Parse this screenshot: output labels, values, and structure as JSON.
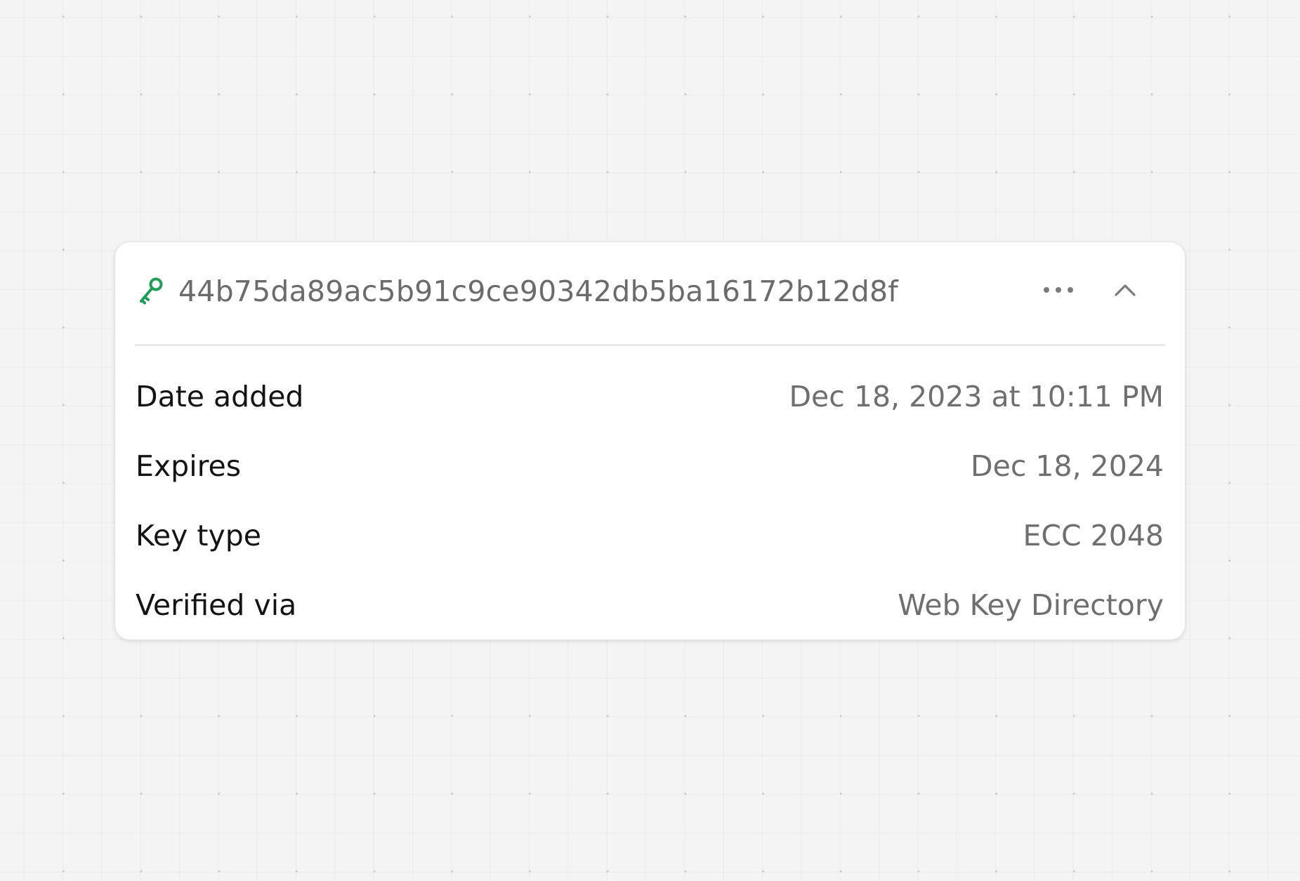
{
  "key_card": {
    "icon": "key-icon",
    "key_id": "44b75da89ac5b91c9ce90342db5ba16172b12d8f",
    "more_icon": "more-horizontal-icon",
    "collapse_icon": "chevron-up-icon",
    "accent_color": "#1f9d55",
    "details": [
      {
        "label": "Date added",
        "value": "Dec 18, 2023 at 10:11 PM"
      },
      {
        "label": "Expires",
        "value": "Dec 18, 2024"
      },
      {
        "label": "Key type",
        "value": "ECC 2048"
      },
      {
        "label": "Verified via",
        "value": "Web Key Directory"
      }
    ]
  }
}
